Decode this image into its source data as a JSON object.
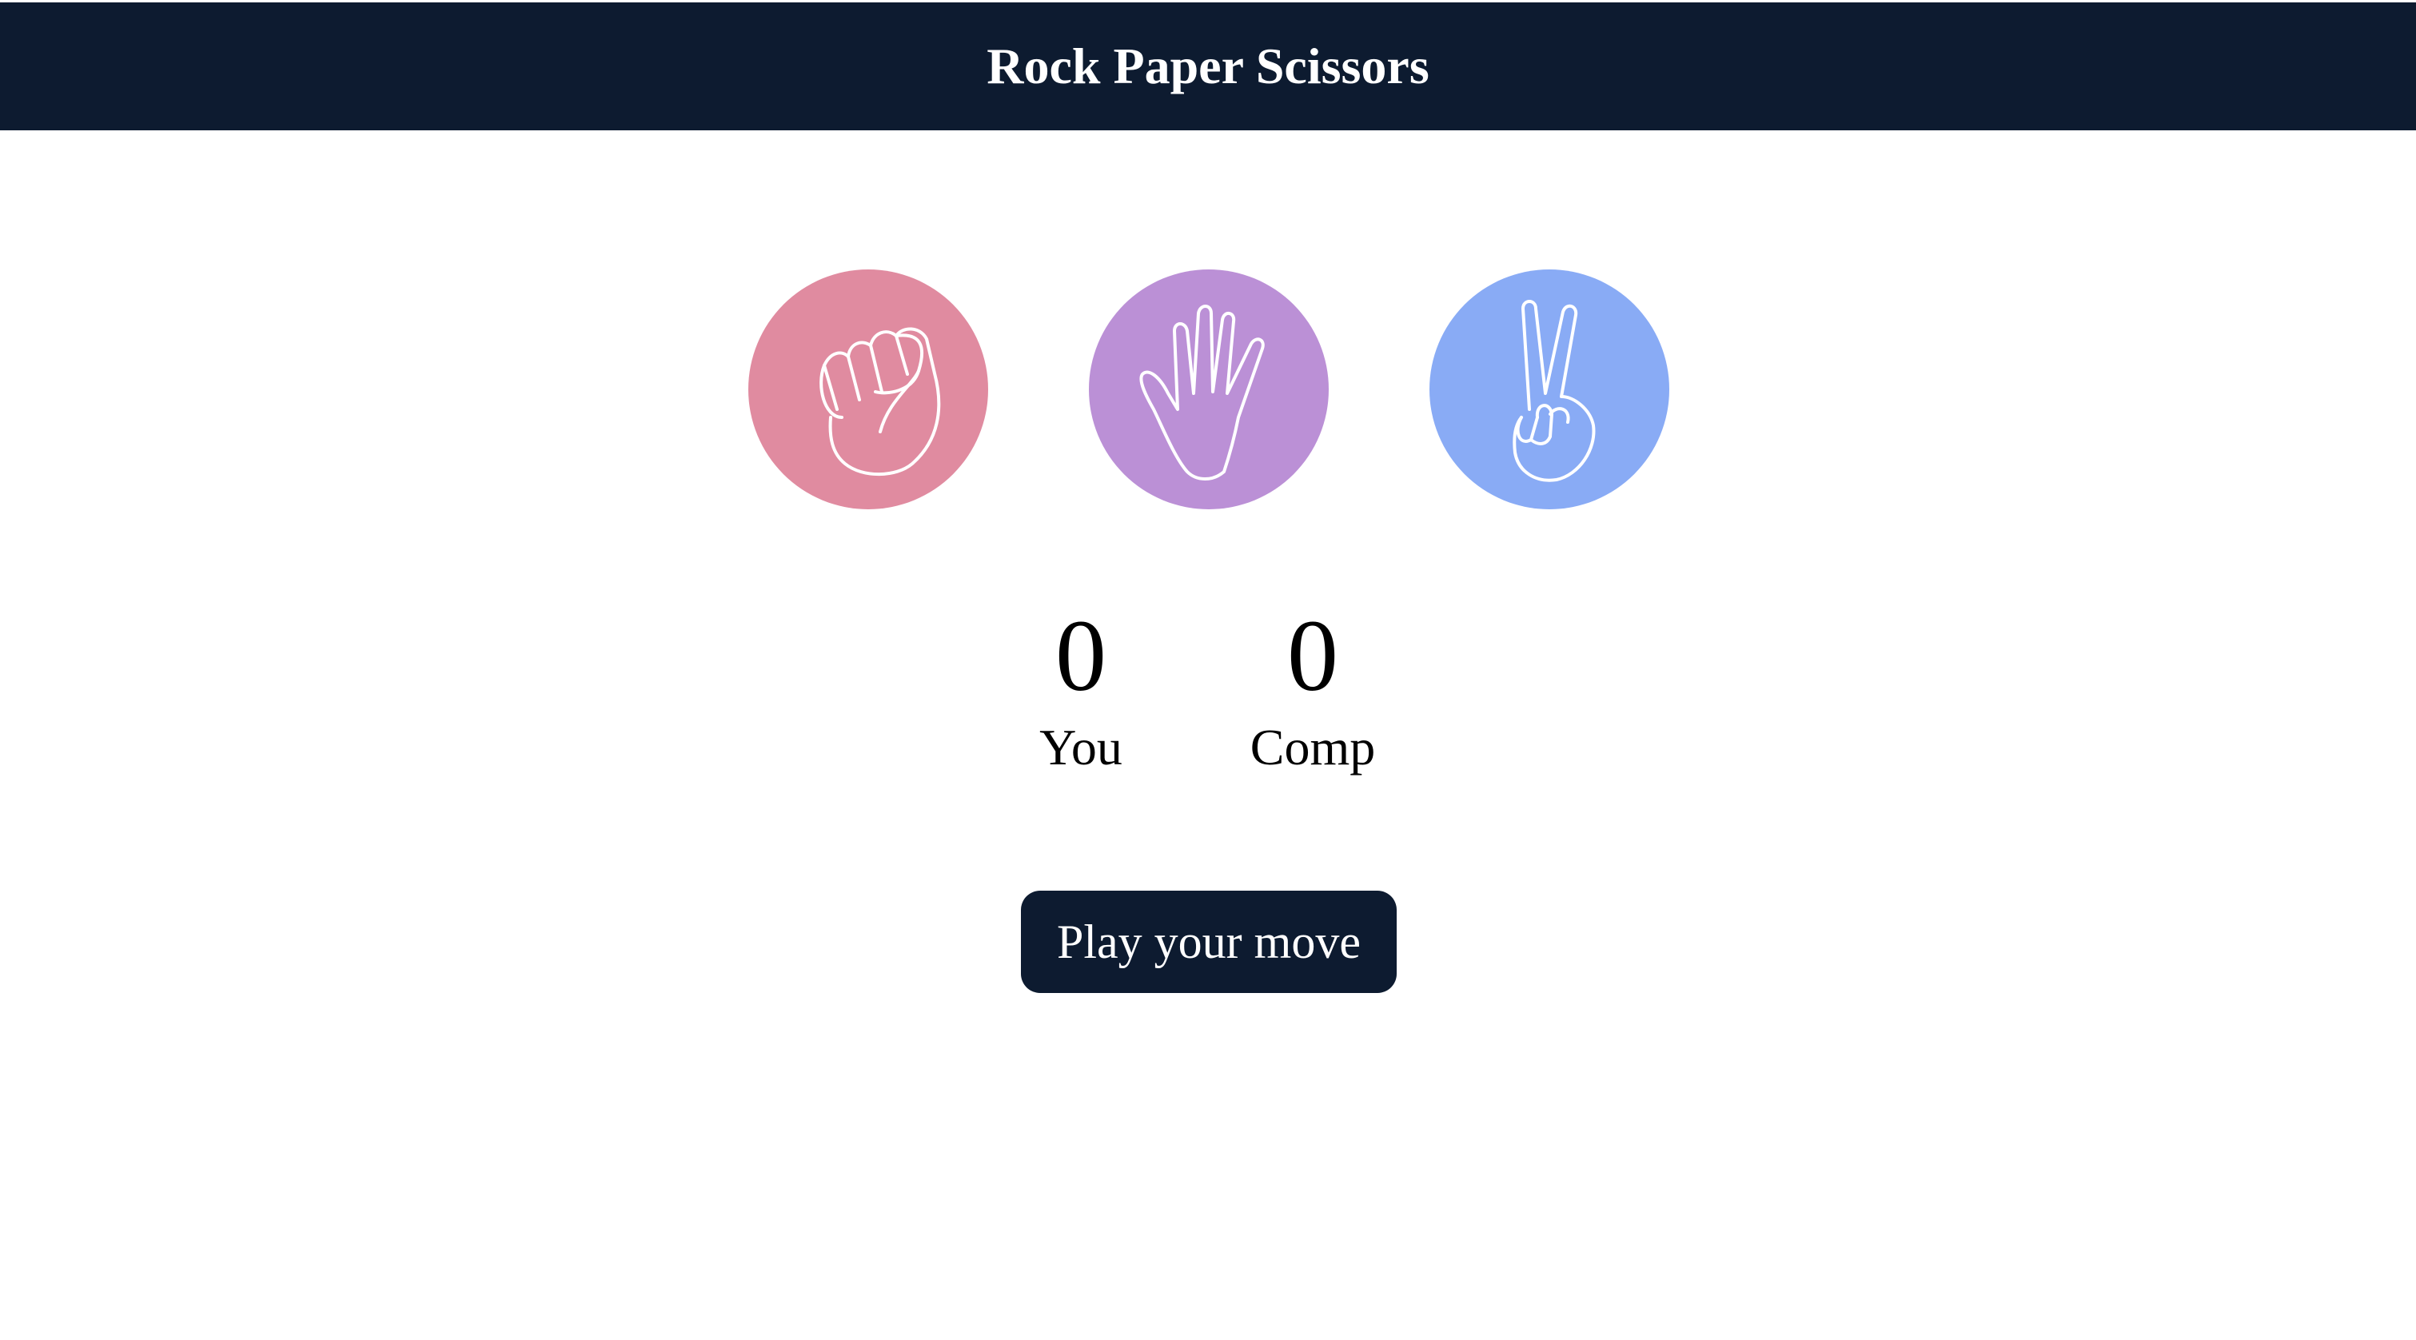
{
  "header": {
    "title": "Rock Paper Scissors"
  },
  "choices": [
    {
      "id": "rock",
      "icon": "fist-icon",
      "color": "#e08ba0"
    },
    {
      "id": "paper",
      "icon": "open-hand-icon",
      "color": "#bb90d6"
    },
    {
      "id": "scissors",
      "icon": "peace-hand-icon",
      "color": "#89abf5"
    }
  ],
  "scoreboard": {
    "user": {
      "value": "0",
      "label": "You"
    },
    "comp": {
      "value": "0",
      "label": "Comp"
    }
  },
  "message": {
    "text": "Play your move"
  },
  "colors": {
    "header_bg": "#0d1b30",
    "message_bg": "#0d1b30"
  }
}
